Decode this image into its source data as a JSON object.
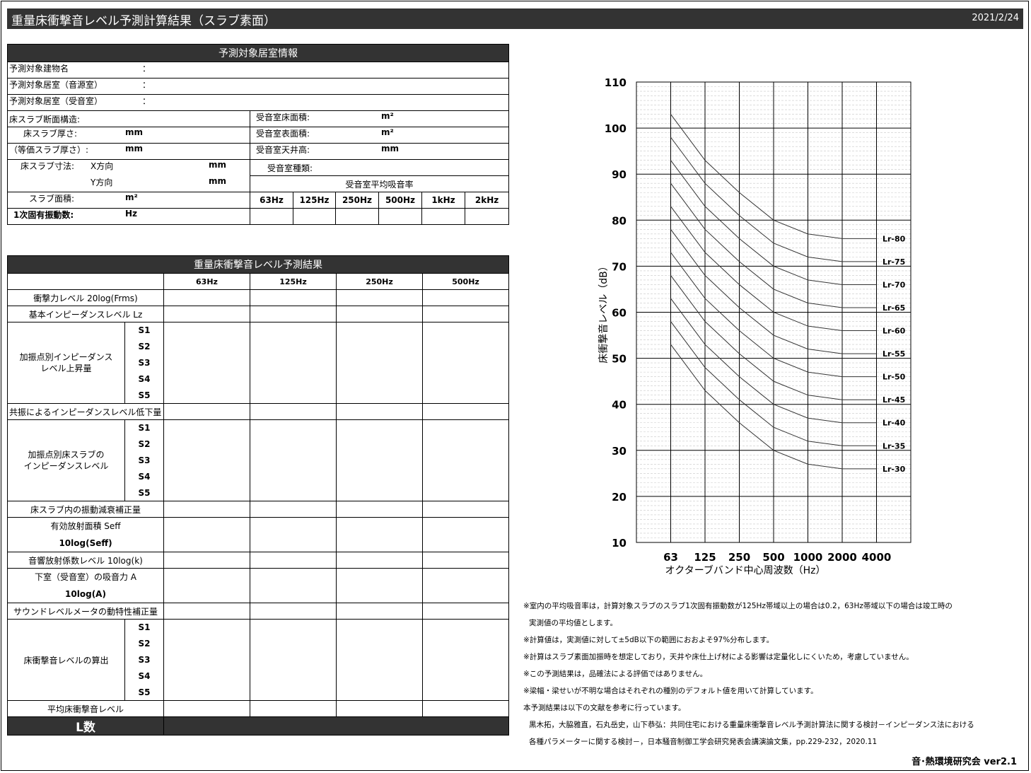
{
  "title": "重量床衝撃音レベル予測計算結果（スラブ素面）",
  "date": "2021/2/24",
  "info": {
    "header": "予測対象居室情報",
    "building": "予測対象建物名",
    "room_src": "予測対象居室（音源室）",
    "room_rcv": "予測対象居室（受音室）",
    "colon": "：",
    "slab_struct": "床スラブ断面構造:",
    "slab_thick": "床スラブ厚さ:",
    "eq_thick": "（等価スラブ厚さ）:",
    "slab_dim": "床スラブ寸法:",
    "x_dir": "X方向",
    "y_dir": "Y方向",
    "slab_area": "スラブ面積:",
    "nat_freq": "1次固有振動数:",
    "rcv_floor": "受音室床面積:",
    "rcv_surface": "受音室表面積:",
    "rcv_ceiling": "受音室天井高:",
    "rcv_type": "受音室種類:",
    "absorption": "受音室平均吸音率",
    "unit_mm": "mm",
    "unit_m2": "m²",
    "unit_hz": "Hz",
    "bands": [
      "63Hz",
      "125Hz",
      "250Hz",
      "500Hz",
      "1kHz",
      "2kHz"
    ]
  },
  "result": {
    "header": "重量床衝撃音レベル予測結果",
    "bands": [
      "63Hz",
      "125Hz",
      "250Hz",
      "500Hz"
    ],
    "r_force": "衝撃力レベル 20log(Frms)",
    "r_basic": "基本インピーダンスレベル Lz",
    "r_rise_1": "加振点別インピーダンス",
    "r_rise_2": "レベル上昇量",
    "r_resonance": "共振によるインピーダンスレベル低下量",
    "r_slab_1": "加振点別床スラブの",
    "r_slab_2": "インピーダンスレベル",
    "r_damping": "床スラブ内の振動減衰補正量",
    "r_area_1": "有効放射面積 Seff",
    "r_area_2": "10log(Seff)",
    "r_radiation": "音響放射係数レベル 10log(k)",
    "r_absorb_1": "下室（受音室）の吸音力 A",
    "r_absorb_2": "10log(A)",
    "r_meter": "サウンドレベルメータの動特性補正量",
    "r_calc": "床衝撃音レベルの算出",
    "r_avg": "平均床衝撃音レベル",
    "l_number": "L数",
    "points": [
      "S1",
      "S2",
      "S3",
      "S4",
      "S5"
    ]
  },
  "notes": [
    "※室内の平均吸音率は，計算対象スラブのスラブ1次固有振動数が125Hz帯域以上の場合は0.2，63Hz帯域以下の場合は竣工時の",
    "実測値の平均値とします。",
    "※計算値は，実測値に対して±5dB以下の範囲におおよそ97%分布します。",
    "※計算はスラブ素面加振時を想定しており，天井や床仕上げ材による影響は定量化しにくいため，考慮していません。",
    "※この予測結果は，品確法による評価ではありません。",
    "※梁幅・梁せいが不明な場合はそれぞれの種別のデフォルト値を用いて計算しています。",
    "本予測結果は以下の文献を参考に行っています。",
    "黒木拓，大脇雅直，石丸岳史，山下恭弘：共同住宅における重量床衝撃音レベル予測計算法に関する検討－インピーダンス法における",
    "各種パラメーターに関する検討－，日本騒音制御工学会研究発表会講演論文集，pp.229-232，2020.11"
  ],
  "footer": "音･熱環境研究会 ver2.1",
  "chart_data": {
    "type": "line",
    "x": [
      "63",
      "125",
      "250",
      "500",
      "1000",
      "2000",
      "4000"
    ],
    "xlabel": "オクターブバンド中心周波数（Hz）",
    "ylabel": "床衝撃音レベル（dB）",
    "ylim": [
      10,
      110
    ],
    "yticks": [
      10,
      20,
      30,
      40,
      50,
      60,
      70,
      80,
      90,
      100,
      110
    ],
    "grid": true,
    "series": [
      {
        "name": "Lr-80",
        "values": [
          103,
          93,
          86,
          80,
          77,
          76,
          76
        ]
      },
      {
        "name": "Lr-75",
        "values": [
          98,
          88,
          81,
          75,
          72,
          71,
          71
        ]
      },
      {
        "name": "Lr-70",
        "values": [
          93,
          83,
          76,
          70,
          67,
          66,
          66
        ]
      },
      {
        "name": "Lr-65",
        "values": [
          88,
          78,
          71,
          65,
          62,
          61,
          61
        ]
      },
      {
        "name": "Lr-60",
        "values": [
          83,
          73,
          66,
          60,
          57,
          56,
          56
        ]
      },
      {
        "name": "Lr-55",
        "values": [
          78,
          68,
          61,
          55,
          52,
          51,
          51
        ]
      },
      {
        "name": "Lr-50",
        "values": [
          73,
          63,
          56,
          50,
          47,
          46,
          46
        ]
      },
      {
        "name": "Lr-45",
        "values": [
          68,
          58,
          51,
          45,
          42,
          41,
          41
        ]
      },
      {
        "name": "Lr-40",
        "values": [
          63,
          53,
          46,
          40,
          37,
          36,
          36
        ]
      },
      {
        "name": "Lr-35",
        "values": [
          58,
          48,
          41,
          35,
          32,
          31,
          31
        ]
      },
      {
        "name": "Lr-30",
        "values": [
          53,
          43,
          36,
          30,
          27,
          26,
          26
        ]
      }
    ]
  }
}
